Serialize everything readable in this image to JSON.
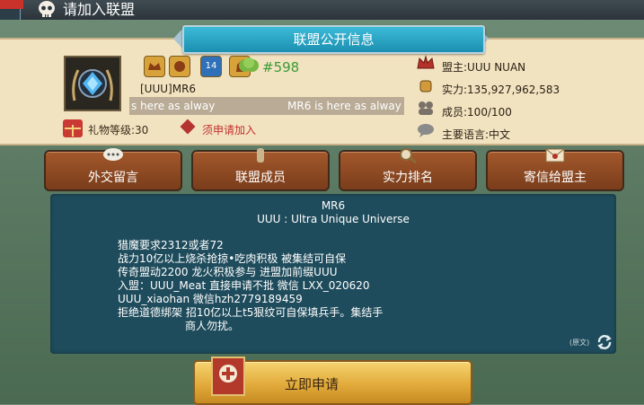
{
  "header": {
    "title": "请加入联盟"
  },
  "alliance": {
    "section_title": "联盟公开信息",
    "tag": "#598",
    "name": "[UUU]MR6",
    "scroll_text_1": "s here as alway",
    "scroll_text_2": "MR6 is here as alway",
    "gift_level": "礼物等级:30",
    "apply_requirement": "须申请加入",
    "leader": "盟主:UUU NUAN",
    "power": "实力:135,927,962,583",
    "members": "成员:100/100",
    "language": "主要语言:中文",
    "badge_level": "14"
  },
  "nav": {
    "diplomacy": "外交留言",
    "members": "联盟成员",
    "ranking": "实力排名",
    "mail_leader": "寄信给盟主"
  },
  "description": {
    "title": "MR6",
    "subtitle": "UUU : Ultra Unique Universe",
    "lines": [
      "猎魔要求2312或者72",
      "战力10亿以上烧杀抢掠•吃肉积极     被集结可自保",
      "传奇盟动2200     龙火积极参与     进盟加前缀UUU",
      "入盟：UUU_Meat 直接申请不批 微信 LXX_020620",
      "UUU_xiaohan                    微信hzh2779189459",
      "拒绝道德绑架   招10亿以上t5狠纹可自保填兵手。集结手",
      "商人勿扰。"
    ],
    "original_tag": "(原文)"
  },
  "apply": {
    "label": "立即申请"
  },
  "colors": {
    "panel_cream": "#f2e3c0",
    "banner_blue": "#1c8fb0",
    "nav_brown": "#7a3d1b",
    "desc_teal": "#1f4c5c",
    "apply_gold": "#e2ab3b",
    "tag_green": "#3c9b36",
    "warning_red": "#c23030"
  },
  "icons": {
    "skull": "skull-icon",
    "gift": "gift-icon",
    "diamond": "diamond-icon",
    "crown": "crown-icon",
    "fist": "fist-icon",
    "members": "members-icon",
    "speech": "speech-icon",
    "chat": "chat-icon",
    "knight": "knight-icon",
    "magnifier": "magnifier-icon",
    "envelope": "envelope-icon",
    "translate": "translate-icon",
    "plus": "plus-icon"
  }
}
